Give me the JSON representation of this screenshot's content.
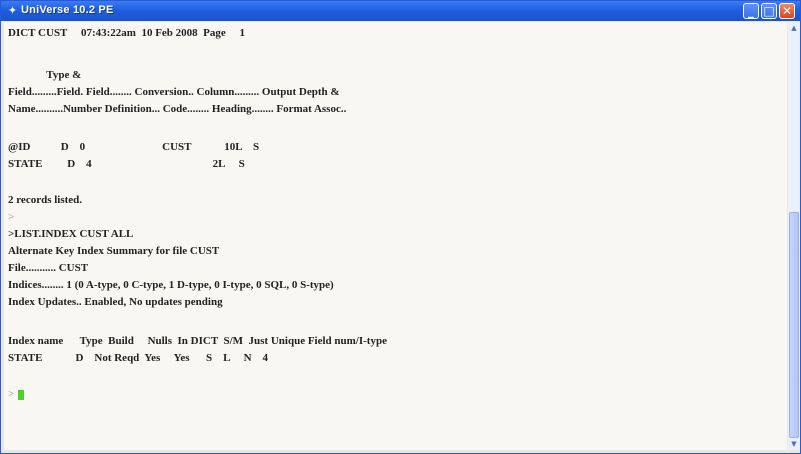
{
  "window": {
    "title": "UniVerse 10.2 PE",
    "title_icon": "universe-app-icon",
    "controls": {
      "minimize": "_",
      "maximize": "□",
      "close": "✕"
    }
  },
  "terminal": {
    "lines": [
      "DICT CUST     07:43:22am  10 Feb 2008  Page     1",
      "",
      "              Type &",
      "Field.........Field. Field........ Conversion.. Column......... Output Depth &",
      "Name..........Number Definition... Code........ Heading........ Format Assoc..",
      "",
      "@ID           D    0                            CUST            10L    S",
      "STATE         D    4                                            2L     S",
      "",
      "2 records listed.",
      ">",
      ">LIST.INDEX CUST ALL",
      "Alternate Key Index Summary for file CUST",
      "File........... CUST",
      "Indices........ 1 (0 A-type, 0 C-type, 1 D-type, 0 I-type, 0 SQL, 0 S-type)",
      "Index Updates.. Enabled, No updates pending",
      "",
      "Index name      Type  Build     Nulls  In DICT  S/M  Just Unique Field num/I-type",
      "STATE            D    Not Reqd  Yes     Yes      S    L     N    4",
      "",
      ">"
    ]
  },
  "colors": {
    "titlebar": "#1f5fe0",
    "terminal_bg": "#f8f7f2",
    "text": "#222222",
    "cursor": "#46d428"
  }
}
